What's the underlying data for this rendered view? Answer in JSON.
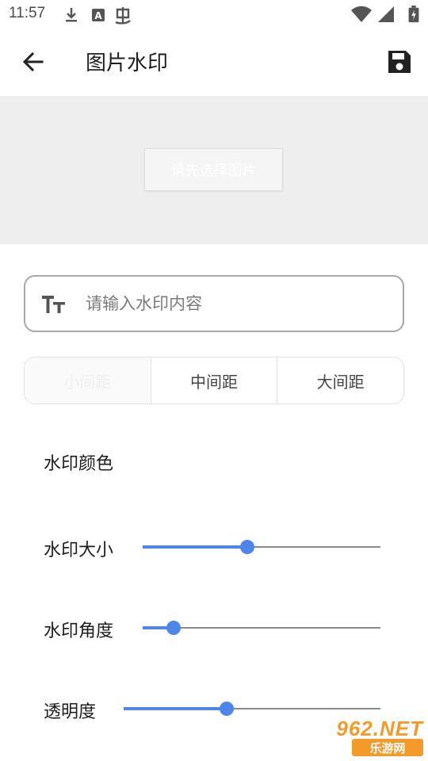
{
  "status_bar": {
    "time": "11:57",
    "icons": [
      "download-icon",
      "a-box-icon",
      "notification-glyph-icon",
      "wifi-icon",
      "cell-signal-icon",
      "battery-icon"
    ]
  },
  "app_bar": {
    "title": "图片水印",
    "back_icon": "arrow-left-icon",
    "save_icon": "floppy-disk-icon"
  },
  "preview": {
    "select_button_label": "请先选择图片"
  },
  "watermark_input": {
    "icon": "text-format-icon",
    "placeholder": "请输入水印内容",
    "value": ""
  },
  "spacing_options": {
    "items": [
      "小间距",
      "中间距",
      "大间距"
    ],
    "selected": "小间距"
  },
  "settings": {
    "color_label": "水印颜色",
    "size_label": "水印大小",
    "size_value": 0.44,
    "angle_label": "水印角度",
    "angle_value": 0.13,
    "opacity_label": "透明度",
    "opacity_value": 0.4
  },
  "accent_color": "#4d86e8",
  "watermark_logo": {
    "top": "962.NET",
    "bottom": "乐游网"
  }
}
